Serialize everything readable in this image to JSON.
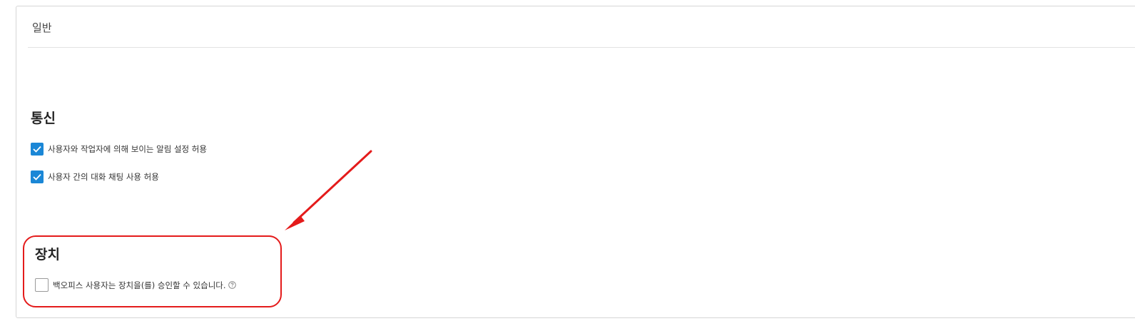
{
  "panel": {
    "title": "일반"
  },
  "communication": {
    "heading": "통신",
    "options": [
      {
        "label": "사용자와 작업자에 의해 보이는 알림 설정 허용",
        "checked": true
      },
      {
        "label": "사용자 간의 대화 채팅 사용 허용",
        "checked": true
      }
    ]
  },
  "devices": {
    "heading": "장치",
    "options": [
      {
        "label": "백오피스 사용자는 장치을(를) 승인할 수 있습니다.",
        "checked": false,
        "has_help_icon": true
      }
    ]
  },
  "annotation": {
    "color": "#e41b1b",
    "icon": "arrow-icon"
  },
  "colors": {
    "checkbox_accent": "#1b87d6"
  }
}
